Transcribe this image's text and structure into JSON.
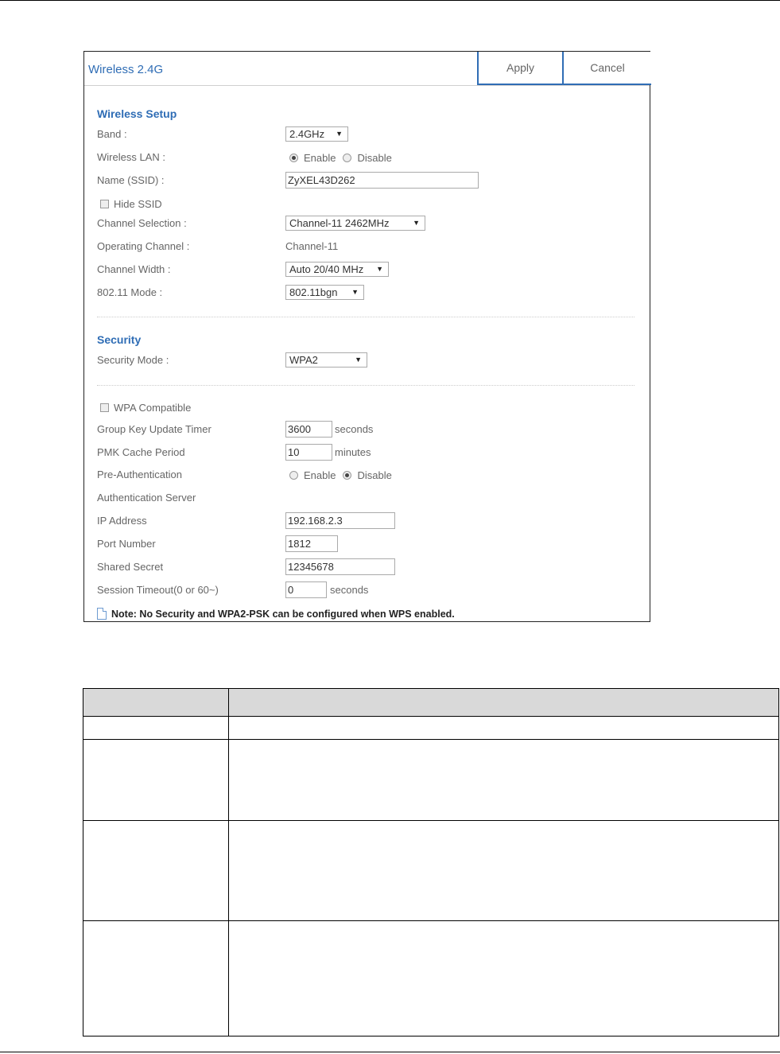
{
  "panel": {
    "title": "Wireless 2.4G",
    "apply_label": "Apply",
    "cancel_label": "Cancel"
  },
  "wireless_setup": {
    "section_title": "Wireless Setup",
    "band_label": "Band :",
    "band_value": "2.4GHz",
    "wlan_label": "Wireless LAN :",
    "enable_label": "Enable",
    "disable_label": "Disable",
    "wlan_selected": "Enable",
    "ssid_label": "Name (SSID) :",
    "ssid_value": "ZyXEL43D262",
    "hide_ssid_label": "Hide SSID",
    "hide_ssid_checked": false,
    "channel_selection_label": "Channel Selection :",
    "channel_selection_value": "Channel-11 2462MHz",
    "operating_channel_label": "Operating Channel :",
    "operating_channel_value": "Channel-11",
    "channel_width_label": "Channel Width :",
    "channel_width_value": "Auto 20/40 MHz",
    "mode_label": "802.11 Mode :",
    "mode_value": "802.11bgn"
  },
  "security": {
    "section_title": "Security",
    "mode_label": "Security Mode :",
    "mode_value": "WPA2"
  },
  "wpa": {
    "compatible_label": "WPA Compatible",
    "compatible_checked": false,
    "group_key_label": "Group Key Update Timer",
    "group_key_value": "3600",
    "group_key_unit": "seconds",
    "pmk_label": "PMK Cache Period",
    "pmk_value": "10",
    "pmk_unit": "minutes",
    "preauth_label": "Pre-Authentication",
    "enable_label": "Enable",
    "disable_label": "Disable",
    "preauth_selected": "Disable",
    "auth_server_label": "Authentication Server",
    "ip_label": "IP Address",
    "ip_value": "192.168.2.3",
    "port_label": "Port Number",
    "port_value": "1812",
    "secret_label": "Shared Secret",
    "secret_value": "12345678",
    "timeout_label": "Session Timeout(0 or 60~)",
    "timeout_value": "0",
    "timeout_unit": "seconds"
  },
  "note": {
    "text": "Note: No Security and WPA2-PSK can be configured when WPS enabled."
  },
  "colors": {
    "accent": "#2f6db5",
    "table_header": "#d9d9d9"
  }
}
